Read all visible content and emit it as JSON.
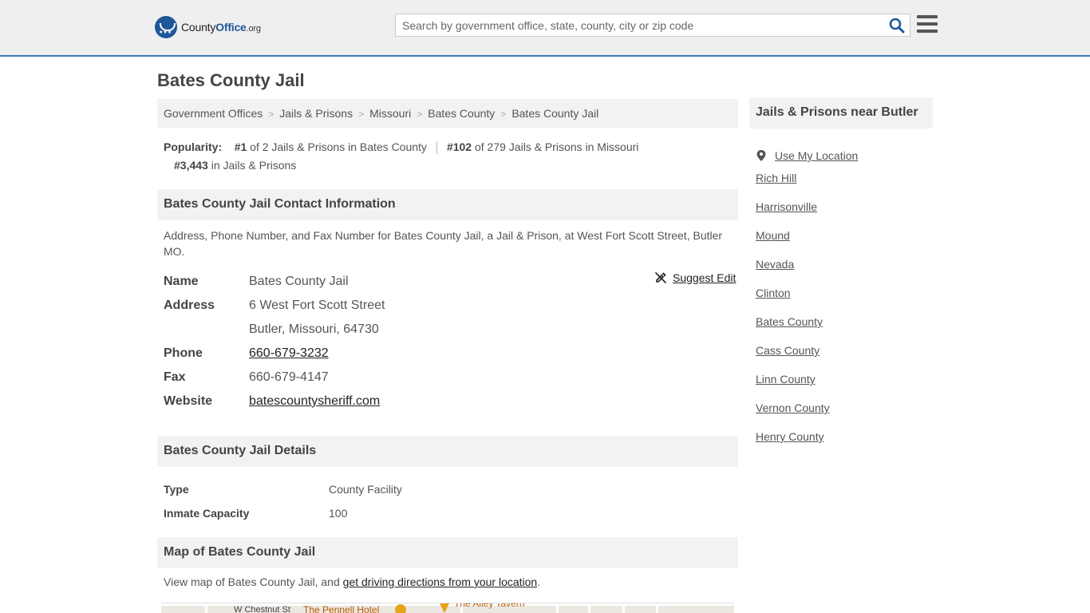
{
  "header": {
    "logo_main": "County",
    "logo_bold": "Office",
    "logo_tld": ".org",
    "search_placeholder": "Search by government office, state, county, city or zip code"
  },
  "page": {
    "title": "Bates County Jail"
  },
  "breadcrumb": [
    "Government Offices",
    "Jails & Prisons",
    "Missouri",
    "Bates County",
    "Bates County Jail"
  ],
  "popularity": {
    "label": "Popularity:",
    "rank1": "#1",
    "rank1_text": "of 2 Jails & Prisons in Bates County",
    "rank2": "#102",
    "rank2_text": "of 279 Jails & Prisons in Missouri",
    "rank3": "#3,443",
    "rank3_text": "in Jails & Prisons"
  },
  "contact": {
    "heading": "Bates County Jail Contact Information",
    "description": "Address, Phone Number, and Fax Number for Bates County Jail, a Jail & Prison, at West Fort Scott Street, Butler MO.",
    "suggest_edit": "Suggest Edit",
    "name_label": "Name",
    "name": "Bates County Jail",
    "address_label": "Address",
    "address_line1": "6 West Fort Scott Street",
    "address_line2": "Butler, Missouri, 64730",
    "phone_label": "Phone",
    "phone": "660-679-3232",
    "fax_label": "Fax",
    "fax": "660-679-4147",
    "website_label": "Website",
    "website": "batescountysheriff.com"
  },
  "details": {
    "heading": "Bates County Jail Details",
    "type_label": "Type",
    "type": "County Facility",
    "capacity_label": "Inmate Capacity",
    "capacity": "100"
  },
  "map_section": {
    "heading": "Map of Bates County Jail",
    "desc_prefix": "View map of Bates County Jail, and ",
    "directions_link": "get driving directions from your location",
    "desc_suffix": ".",
    "street1": "W Chestnut St",
    "poi1": "The Pennell Hotel",
    "poi2": "The Alley Tavern"
  },
  "sidebar": {
    "heading": "Jails & Prisons near Butler",
    "use_location": "Use My Location",
    "items": [
      "Rich Hill",
      "Harrisonville",
      "Mound",
      "Nevada",
      "Clinton",
      "Bates County",
      "Cass County",
      "Linn County",
      "Vernon County",
      "Henry County"
    ]
  },
  "colors": {
    "brand_blue": "#1e5799",
    "header_border": "#3f7cb6",
    "panel_gray": "#f2f2f2"
  }
}
